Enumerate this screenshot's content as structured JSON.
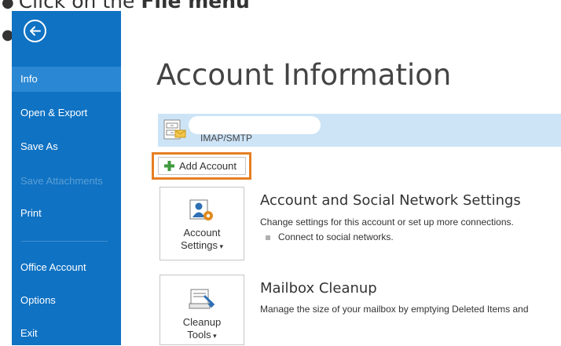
{
  "instructions": {
    "line1_prefix": "Click on the ",
    "line1_bold": "File menu",
    "line2": ""
  },
  "sidebar": {
    "back_icon": "back-arrow-icon",
    "items": [
      {
        "label": "Info",
        "active": true
      },
      {
        "label": "Open & Export"
      },
      {
        "label": "Save As"
      },
      {
        "label": "Save Attachments",
        "disabled": true
      },
      {
        "label": "Print"
      },
      {
        "label": "Office Account"
      },
      {
        "label": "Options"
      },
      {
        "label": "Exit"
      }
    ]
  },
  "main": {
    "title": "Account Information",
    "account": {
      "type": "IMAP/SMTP",
      "icon": "email-account-icon"
    },
    "add_account_label": "Add Account",
    "sections": [
      {
        "tile_line1": "Account",
        "tile_line2": "Settings",
        "tile_icon": "account-settings-icon",
        "title": "Account and Social Network Settings",
        "description": "Change settings for this account or set up more connections.",
        "sub_link": "Connect to social networks."
      },
      {
        "tile_line1": "Cleanup",
        "tile_line2": "Tools",
        "tile_icon": "cleanup-tools-icon",
        "title": "Mailbox Cleanup",
        "description": "Manage the size of your mailbox by emptying Deleted Items and"
      }
    ]
  },
  "colors": {
    "sidebar_bg": "#0f72c3",
    "sidebar_active": "#2a87d3",
    "account_bar": "#cde4f7",
    "highlight": "#e67e22"
  }
}
